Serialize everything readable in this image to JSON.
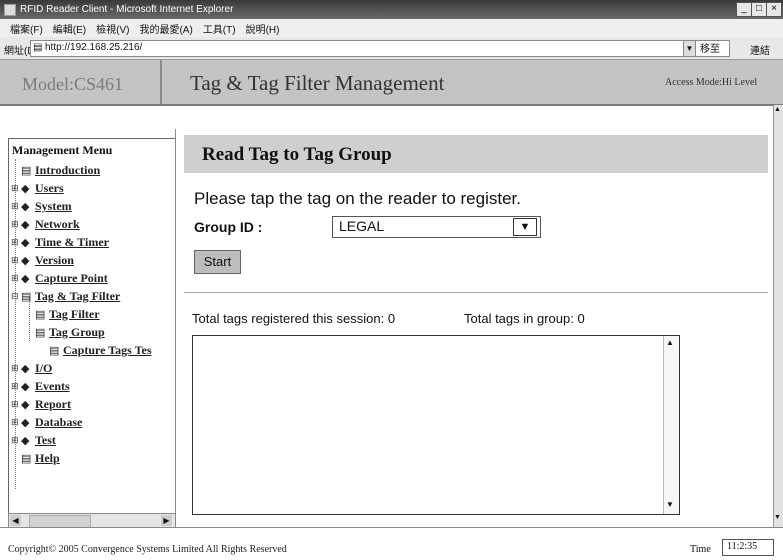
{
  "window": {
    "title": "RFID Reader Client - Microsoft Internet Explorer",
    "controls": [
      "_",
      "□",
      "×"
    ]
  },
  "menubar": {
    "items": [
      "檔案(F)",
      "編輯(E)",
      "檢視(V)",
      "我的最愛(A)",
      "工具(T)",
      "說明(H)"
    ]
  },
  "addressbar": {
    "label": "網址(D)",
    "url": "http://192.168.25.216/",
    "go_label": "移至",
    "links_label": "連結"
  },
  "header": {
    "model": "Model:CS461",
    "title": "Tag & Tag Filter Management",
    "access_mode": "Access Mode:Hi Level"
  },
  "sidebar": {
    "title": "Management Menu",
    "items": [
      {
        "label": "Introduction"
      },
      {
        "label": "Users"
      },
      {
        "label": "System"
      },
      {
        "label": "Network"
      },
      {
        "label": "Time & Timer"
      },
      {
        "label": "Version"
      },
      {
        "label": "Capture Point"
      },
      {
        "label": "Tag & Tag Filter"
      },
      {
        "label": "Tag Filter"
      },
      {
        "label": "Tag Group"
      },
      {
        "label": "Capture Tags Tes"
      },
      {
        "label": "I/O"
      },
      {
        "label": "Events"
      },
      {
        "label": "Report"
      },
      {
        "label": "Database"
      },
      {
        "label": "Test"
      },
      {
        "label": "Help"
      }
    ]
  },
  "main": {
    "heading": "Read Tag to Tag Group",
    "instruction": "Please tap the tag on the reader to register.",
    "group_label": "Group ID :",
    "group_value": "LEGAL",
    "start_label": "Start",
    "session_total": "Total tags registered this session: 0",
    "group_total": "Total tags in group: 0",
    "log_text": ""
  },
  "footer": {
    "copyright": "Copyright© 2005 Convergence Systems Limited  All Rights Reserved",
    "time_label": "Time",
    "time_value": "11:2:35"
  },
  "icons": {
    "expand": "⊞",
    "collapse": "⊟",
    "page": "▤",
    "folder": "◆",
    "dropdown": "▼"
  }
}
